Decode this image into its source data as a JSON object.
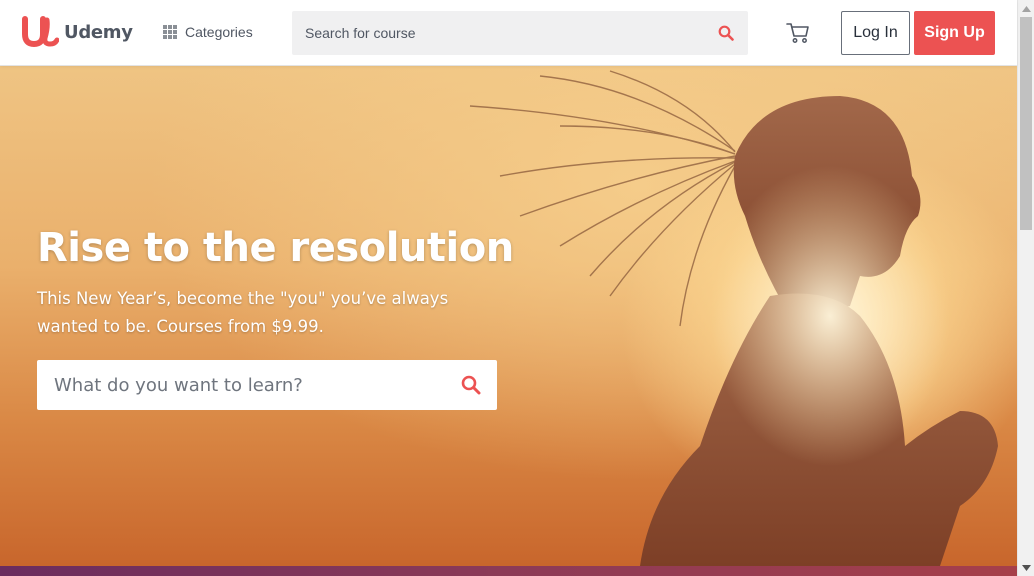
{
  "header": {
    "logo_text": "Udemy",
    "categories_label": "Categories",
    "search_placeholder": "Search for course",
    "login_label": "Log In",
    "signup_label": "Sign Up"
  },
  "hero": {
    "title": "Rise to the resolution",
    "subtitle": "This New Year’s, become the \"you\" you’ve always wanted to be. Courses from $9.99.",
    "search_placeholder": "What do you want to learn?"
  },
  "icons": {
    "logo": "udemy-logo-icon",
    "categories": "grid-icon",
    "search": "search-icon",
    "cart": "cart-icon"
  },
  "colors": {
    "brand": "#ec5252",
    "text_dark": "#29303b",
    "text_gray": "#505763"
  }
}
